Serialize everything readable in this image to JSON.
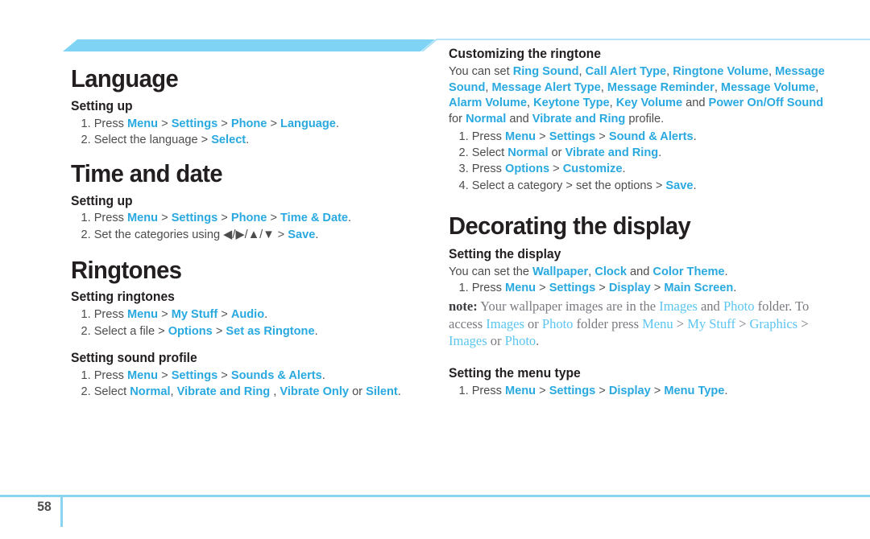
{
  "theme": {
    "accent_blue": "#29a9e0",
    "deco_bar": "#7fd4f5",
    "rule": "#8ad4f2",
    "note_blue": "#5bc5f0",
    "body_gray": "#4d4d4d"
  },
  "footer": {
    "page_number": "58"
  },
  "left_column": {
    "sections": [
      {
        "title": "Language",
        "subsections": [
          {
            "heading": "Setting up",
            "steps": [
              {
                "num": "1.",
                "parts": [
                  {
                    "t": "Press ",
                    "style": "plain"
                  },
                  {
                    "t": "Menu",
                    "style": "blue"
                  },
                  {
                    "t": " > ",
                    "style": "sep"
                  },
                  {
                    "t": "Settings",
                    "style": "blue"
                  },
                  {
                    "t": " > ",
                    "style": "sep"
                  },
                  {
                    "t": "Phone",
                    "style": "blue"
                  },
                  {
                    "t": " > ",
                    "style": "sep"
                  },
                  {
                    "t": "Language",
                    "style": "blue"
                  },
                  {
                    "t": ".",
                    "style": "plain"
                  }
                ]
              },
              {
                "num": "2.",
                "parts": [
                  {
                    "t": "Select the language > ",
                    "style": "plain"
                  },
                  {
                    "t": "Select",
                    "style": "blue"
                  },
                  {
                    "t": ".",
                    "style": "plain"
                  }
                ]
              }
            ]
          }
        ]
      },
      {
        "title": "Time and date",
        "subsections": [
          {
            "heading": "Setting up",
            "steps": [
              {
                "num": "1.",
                "parts": [
                  {
                    "t": "Press ",
                    "style": "plain"
                  },
                  {
                    "t": "Menu",
                    "style": "blue"
                  },
                  {
                    "t": " > ",
                    "style": "sep"
                  },
                  {
                    "t": "Settings",
                    "style": "blue"
                  },
                  {
                    "t": " > ",
                    "style": "sep"
                  },
                  {
                    "t": "Phone",
                    "style": "blue"
                  },
                  {
                    "t": " > ",
                    "style": "sep"
                  },
                  {
                    "t": "Time & Date",
                    "style": "blue"
                  },
                  {
                    "t": ".",
                    "style": "plain"
                  }
                ]
              },
              {
                "num": "2.",
                "parts": [
                  {
                    "t": "Set the categories using ",
                    "style": "plain"
                  },
                  {
                    "t": "◀/▶/▲/▼",
                    "style": "arrows"
                  },
                  {
                    "t": " > ",
                    "style": "sep"
                  },
                  {
                    "t": "Save",
                    "style": "blue"
                  },
                  {
                    "t": ".",
                    "style": "plain"
                  }
                ]
              }
            ]
          }
        ]
      },
      {
        "title": "Ringtones",
        "subsections": [
          {
            "heading": "Setting ringtones",
            "steps": [
              {
                "num": "1.",
                "parts": [
                  {
                    "t": "Press ",
                    "style": "plain"
                  },
                  {
                    "t": "Menu",
                    "style": "blue"
                  },
                  {
                    "t": " > ",
                    "style": "sep"
                  },
                  {
                    "t": "My Stuff",
                    "style": "blue"
                  },
                  {
                    "t": " > ",
                    "style": "sep"
                  },
                  {
                    "t": "Audio",
                    "style": "blue"
                  },
                  {
                    "t": ".",
                    "style": "plain"
                  }
                ]
              },
              {
                "num": "2.",
                "parts": [
                  {
                    "t": " Select a file > ",
                    "style": "plain"
                  },
                  {
                    "t": "Options",
                    "style": "blue"
                  },
                  {
                    "t": " > ",
                    "style": "sep"
                  },
                  {
                    "t": "Set as Ringtone",
                    "style": "blue"
                  },
                  {
                    "t": ".",
                    "style": "plain"
                  }
                ]
              }
            ]
          },
          {
            "heading": "Setting sound profile",
            "steps": [
              {
                "num": "1.",
                "parts": [
                  {
                    "t": "Press ",
                    "style": "plain"
                  },
                  {
                    "t": "Menu",
                    "style": "blue"
                  },
                  {
                    "t": " > ",
                    "style": "sep"
                  },
                  {
                    "t": "Settings",
                    "style": "blue"
                  },
                  {
                    "t": " > ",
                    "style": "sep"
                  },
                  {
                    "t": "Sounds & Alerts",
                    "style": "blue"
                  },
                  {
                    "t": ".",
                    "style": "plain"
                  }
                ]
              },
              {
                "num": "2.",
                "parts": [
                  {
                    "t": "Select ",
                    "style": "plain"
                  },
                  {
                    "t": "Normal",
                    "style": "blue"
                  },
                  {
                    "t": ", ",
                    "style": "plain"
                  },
                  {
                    "t": "Vibrate and Ring",
                    "style": "blue"
                  },
                  {
                    "t": " , ",
                    "style": "plain"
                  },
                  {
                    "t": "Vibrate Only",
                    "style": "blue"
                  },
                  {
                    "t": " or ",
                    "style": "plain"
                  },
                  {
                    "t": "Silent",
                    "style": "blue"
                  },
                  {
                    "t": ".",
                    "style": "plain"
                  }
                ]
              }
            ]
          }
        ]
      }
    ]
  },
  "right_column": {
    "customizing": {
      "heading": "Customizing the ringtone",
      "intro_parts": [
        {
          "t": "You can set ",
          "style": "plain"
        },
        {
          "t": "Ring Sound",
          "style": "blue"
        },
        {
          "t": ", ",
          "style": "plain"
        },
        {
          "t": "Call Alert Type",
          "style": "blue"
        },
        {
          "t": ", ",
          "style": "plain"
        },
        {
          "t": "Ringtone Volume",
          "style": "blue"
        },
        {
          "t": ", ",
          "style": "plain"
        },
        {
          "t": "Message Sound",
          "style": "blue"
        },
        {
          "t": ", ",
          "style": "plain"
        },
        {
          "t": "Message Alert Type",
          "style": "blue"
        },
        {
          "t": ", ",
          "style": "plain"
        },
        {
          "t": "Message Reminder",
          "style": "blue"
        },
        {
          "t": ", ",
          "style": "plain"
        },
        {
          "t": "Message Volume",
          "style": "blue"
        },
        {
          "t": ", ",
          "style": "plain"
        },
        {
          "t": "Alarm Volume",
          "style": "blue"
        },
        {
          "t": ", ",
          "style": "plain"
        },
        {
          "t": "Keytone Type",
          "style": "blue"
        },
        {
          "t": ", ",
          "style": "plain"
        },
        {
          "t": "Key Volume",
          "style": "blue"
        },
        {
          "t": " and ",
          "style": "plain"
        },
        {
          "t": "Power On/Off Sound",
          "style": "blue"
        },
        {
          "t": " for ",
          "style": "plain"
        },
        {
          "t": "Normal",
          "style": "blue"
        },
        {
          "t": " and ",
          "style": "plain"
        },
        {
          "t": "Vibrate and Ring",
          "style": "blue"
        },
        {
          "t": " profile.",
          "style": "plain"
        }
      ],
      "steps": [
        {
          "num": "1.",
          "parts": [
            {
              "t": "Press ",
              "style": "plain"
            },
            {
              "t": "Menu",
              "style": "blue"
            },
            {
              "t": " > ",
              "style": "sep"
            },
            {
              "t": "Settings",
              "style": "blue"
            },
            {
              "t": " > ",
              "style": "sep"
            },
            {
              "t": "Sound & Alerts",
              "style": "blue"
            },
            {
              "t": ".",
              "style": "plain"
            }
          ]
        },
        {
          "num": "2.",
          "parts": [
            {
              "t": "Select ",
              "style": "plain"
            },
            {
              "t": "Normal",
              "style": "blue"
            },
            {
              "t": " or ",
              "style": "plain"
            },
            {
              "t": "Vibrate and Ring",
              "style": "blue"
            },
            {
              "t": ".",
              "style": "plain"
            }
          ]
        },
        {
          "num": "3.",
          "parts": [
            {
              "t": "Press ",
              "style": "plain"
            },
            {
              "t": "Options",
              "style": "blue"
            },
            {
              "t": " > ",
              "style": "sep"
            },
            {
              "t": "Customize",
              "style": "blue"
            },
            {
              "t": ".",
              "style": "plain"
            }
          ]
        },
        {
          "num": "4.",
          "parts": [
            {
              "t": "Select a category > set the options > ",
              "style": "plain"
            },
            {
              "t": "Save",
              "style": "blue"
            },
            {
              "t": ".",
              "style": "plain"
            }
          ]
        }
      ]
    },
    "decorating": {
      "title": "Decorating the display",
      "display": {
        "heading": "Setting the display",
        "intro_parts": [
          {
            "t": "You can set the ",
            "style": "plain"
          },
          {
            "t": "Wallpaper",
            "style": "blue"
          },
          {
            "t": ", ",
            "style": "plain"
          },
          {
            "t": "Clock",
            "style": "blue"
          },
          {
            "t": " and ",
            "style": "plain"
          },
          {
            "t": "Color Theme",
            "style": "blue"
          },
          {
            "t": ".",
            "style": "plain"
          }
        ],
        "steps": [
          {
            "num": "1.",
            "parts": [
              {
                "t": "Press ",
                "style": "plain"
              },
              {
                "t": "Menu",
                "style": "blue"
              },
              {
                "t": " > ",
                "style": "sep"
              },
              {
                "t": "Settings",
                "style": "blue"
              },
              {
                "t": " > ",
                "style": "sep"
              },
              {
                "t": "Display",
                "style": "blue"
              },
              {
                "t": " > ",
                "style": "sep"
              },
              {
                "t": "Main Screen",
                "style": "blue"
              },
              {
                "t": ".",
                "style": "plain"
              }
            ]
          }
        ],
        "note_parts": [
          {
            "t": "note:",
            "style": "note-bold"
          },
          {
            "t": " Your wallpaper images are in the ",
            "style": "note-plain"
          },
          {
            "t": "Images",
            "style": "note-blue"
          },
          {
            "t": " and ",
            "style": "note-plain"
          },
          {
            "t": "Photo",
            "style": "note-blue"
          },
          {
            "t": " folder. To access ",
            "style": "note-plain"
          },
          {
            "t": "Images",
            "style": "note-blue"
          },
          {
            "t": " or ",
            "style": "note-plain"
          },
          {
            "t": "Photo",
            "style": "note-blue"
          },
          {
            "t": " folder press ",
            "style": "note-plain"
          },
          {
            "t": "Menu",
            "style": "note-blue"
          },
          {
            "t": " > ",
            "style": "note-plain"
          },
          {
            "t": "My Stuff",
            "style": "note-blue"
          },
          {
            "t": " > ",
            "style": "note-plain"
          },
          {
            "t": "Graphics",
            "style": "note-blue"
          },
          {
            "t": " > ",
            "style": "note-plain"
          },
          {
            "t": "Images",
            "style": "note-blue"
          },
          {
            "t": " or ",
            "style": "note-plain"
          },
          {
            "t": "Photo",
            "style": "note-blue"
          },
          {
            "t": ".",
            "style": "note-plain"
          }
        ]
      },
      "menu_type": {
        "heading": "Setting the menu type",
        "steps": [
          {
            "num": "1.",
            "parts": [
              {
                "t": "Press ",
                "style": "plain"
              },
              {
                "t": "Menu",
                "style": "blue"
              },
              {
                "t": " > ",
                "style": "sep"
              },
              {
                "t": "Settings",
                "style": "blue"
              },
              {
                "t": " > ",
                "style": "sep"
              },
              {
                "t": "Display",
                "style": "blue"
              },
              {
                "t": " > ",
                "style": "sep"
              },
              {
                "t": "Menu Type",
                "style": "blue"
              },
              {
                "t": ".",
                "style": "plain"
              }
            ]
          }
        ]
      }
    }
  }
}
